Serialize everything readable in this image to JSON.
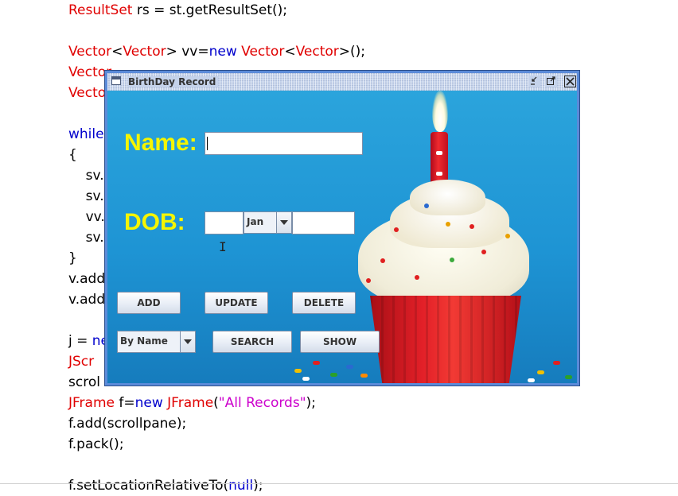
{
  "code_lines": [
    [
      {
        "t": "ResultSet",
        "c": "t"
      },
      {
        "t": " rs = st.getResultSet();",
        "c": ""
      }
    ],
    [],
    [
      {
        "t": "Vector",
        "c": "t"
      },
      {
        "t": "<",
        "c": ""
      },
      {
        "t": "Vector",
        "c": "t"
      },
      {
        "t": "> vv=",
        "c": ""
      },
      {
        "t": "new",
        "c": "k"
      },
      {
        "t": " ",
        "c": ""
      },
      {
        "t": "Vector",
        "c": "t"
      },
      {
        "t": "<",
        "c": ""
      },
      {
        "t": "Vector",
        "c": "t"
      },
      {
        "t": ">();",
        "c": ""
      }
    ],
    [
      {
        "t": "Vector",
        "c": "t"
      }
    ],
    [
      {
        "t": "Vector",
        "c": "t"
      }
    ],
    [],
    [
      {
        "t": "while",
        "c": "k"
      }
    ],
    [
      {
        "t": "{",
        "c": ""
      }
    ],
    [
      {
        "t": "    sv.",
        "c": ""
      }
    ],
    [
      {
        "t": "    sv.",
        "c": ""
      }
    ],
    [
      {
        "t": "    vv.",
        "c": ""
      }
    ],
    [
      {
        "t": "    sv.",
        "c": ""
      }
    ],
    [
      {
        "t": "}",
        "c": ""
      }
    ],
    [
      {
        "t": "v.add",
        "c": ""
      }
    ],
    [
      {
        "t": "v.add",
        "c": ""
      }
    ],
    [],
    [
      {
        "t": "j = ",
        "c": ""
      },
      {
        "t": "ne",
        "c": "k"
      }
    ],
    [
      {
        "t": "JScr",
        "c": "t"
      }
    ],
    [
      {
        "t": "scrol",
        "c": ""
      }
    ],
    [
      {
        "t": "JFrame",
        "c": "t"
      },
      {
        "t": " f=",
        "c": ""
      },
      {
        "t": "new",
        "c": "k"
      },
      {
        "t": " ",
        "c": ""
      },
      {
        "t": "JFrame",
        "c": "t"
      },
      {
        "t": "(",
        "c": ""
      },
      {
        "t": "\"All Records\"",
        "c": "s"
      },
      {
        "t": ");",
        "c": ""
      }
    ],
    [
      {
        "t": "f.add(scrollpane);",
        "c": ""
      }
    ],
    [
      {
        "t": "f.pack();",
        "c": ""
      }
    ],
    [],
    [
      {
        "t": "f.setLocationRelativeTo(",
        "c": ""
      },
      {
        "t": "null",
        "c": "k"
      },
      {
        "t": ");",
        "c": ""
      }
    ]
  ],
  "colors": {
    "keyword": "#0000cc",
    "type": "#e00000",
    "string": "#cc00cc",
    "label": "#f5f500",
    "window_border": "#5b8bd9"
  },
  "window": {
    "title": "BirthDay Record",
    "title_icon": "window-icon",
    "controls": {
      "minimize": "minimize-icon",
      "maximize": "maximize-icon",
      "close": "close-icon"
    }
  },
  "form": {
    "name_label": "Name:",
    "name_value": "",
    "dob_label": "DOB:",
    "day_value": "",
    "month_selected": "Jan",
    "year_value": "",
    "search_by_selected": "By Name"
  },
  "buttons": {
    "add": "ADD",
    "update": "UPDATE",
    "delete": "DELETE",
    "search": "SEARCH",
    "show": "SHOW"
  },
  "background_image": "birthday-cupcake-with-candle"
}
